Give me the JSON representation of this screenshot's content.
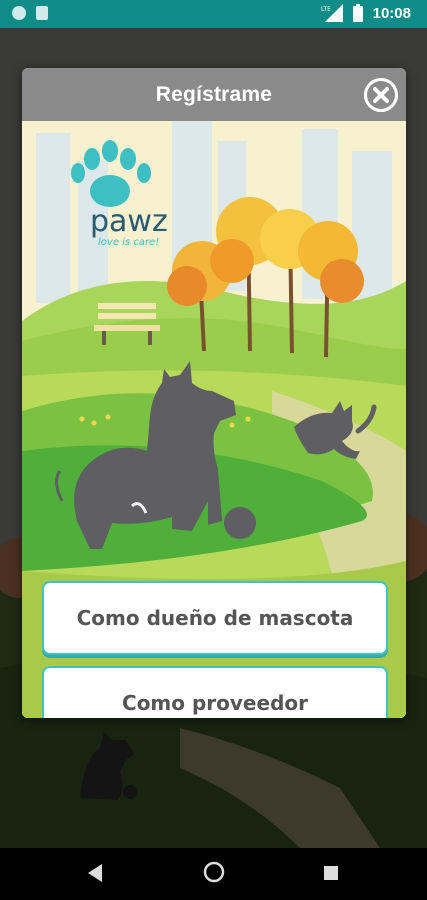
{
  "status_bar": {
    "time": "10:08",
    "network_label": "LTE",
    "icons": [
      "notification-dot-icon",
      "sd-card-icon",
      "signal-icon",
      "battery-icon"
    ]
  },
  "dialog": {
    "title": "Regístrame",
    "close_icon": "close-icon",
    "logo": {
      "name": "pawz",
      "tagline": "love is care!"
    },
    "buttons": {
      "owner_label": "Como dueño de mascota",
      "provider_label": "Como proveedor"
    }
  },
  "nav_bar": {
    "icons": [
      "back-icon",
      "home-icon",
      "recents-icon"
    ]
  },
  "colors": {
    "status_bar": "#0f8c88",
    "header": "#8a8a8a",
    "button_border": "#3cc4c0",
    "grass": "#7cc242",
    "dog_silhouette": "#5e5e63"
  }
}
